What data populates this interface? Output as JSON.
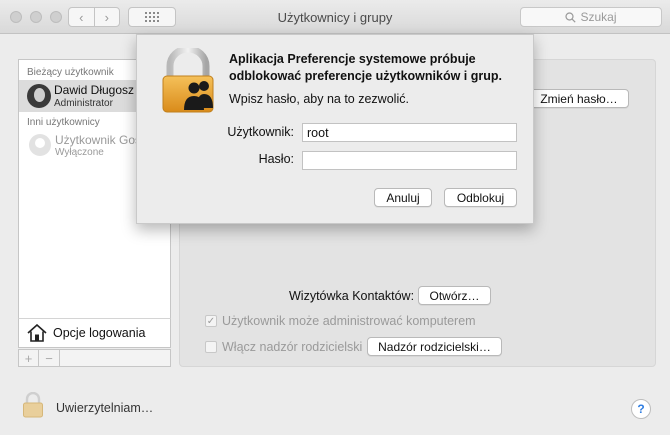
{
  "window": {
    "title": "Użytkownicy i grupy",
    "search_placeholder": "Szukaj"
  },
  "sidebar": {
    "current_header": "Bieżący użytkownik",
    "current_user": {
      "name": "Dawid Długosz",
      "role": "Administrator"
    },
    "other_header": "Inni użytkownicy",
    "other_user": {
      "name": "Użytkownik Gość",
      "status": "Wyłączone"
    },
    "login_options_label": "Opcje logowania",
    "add_label": "+",
    "remove_label": "−"
  },
  "main": {
    "change_password_label": "Zmień hasło…",
    "contact_card_label": "Wizytówka Kontaktów:",
    "open_label": "Otwórz…",
    "admin_checkbox": {
      "label": "Użytkownik może administrować komputerem",
      "checked": true
    },
    "parental_checkbox": {
      "label": "Włącz nadzór rodzicielski",
      "checked": false
    },
    "parental_button_label": "Nadzór rodzicielski…"
  },
  "footer": {
    "auth_label": "Uwierzytelniam…",
    "help_label": "?"
  },
  "dialog": {
    "title": "Aplikacja Preferencje systemowe próbuje odblokować preferencje użytkowników i grup.",
    "message": "Wpisz hasło, aby na to zezwolić.",
    "username_label": "Użytkownik:",
    "username_value": "root",
    "password_label": "Hasło:",
    "password_value": "",
    "cancel_label": "Anuluj",
    "unlock_label": "Odblokuj"
  },
  "colors": {
    "lock_gold": "#e8a534",
    "help_blue": "#2f7de1"
  }
}
